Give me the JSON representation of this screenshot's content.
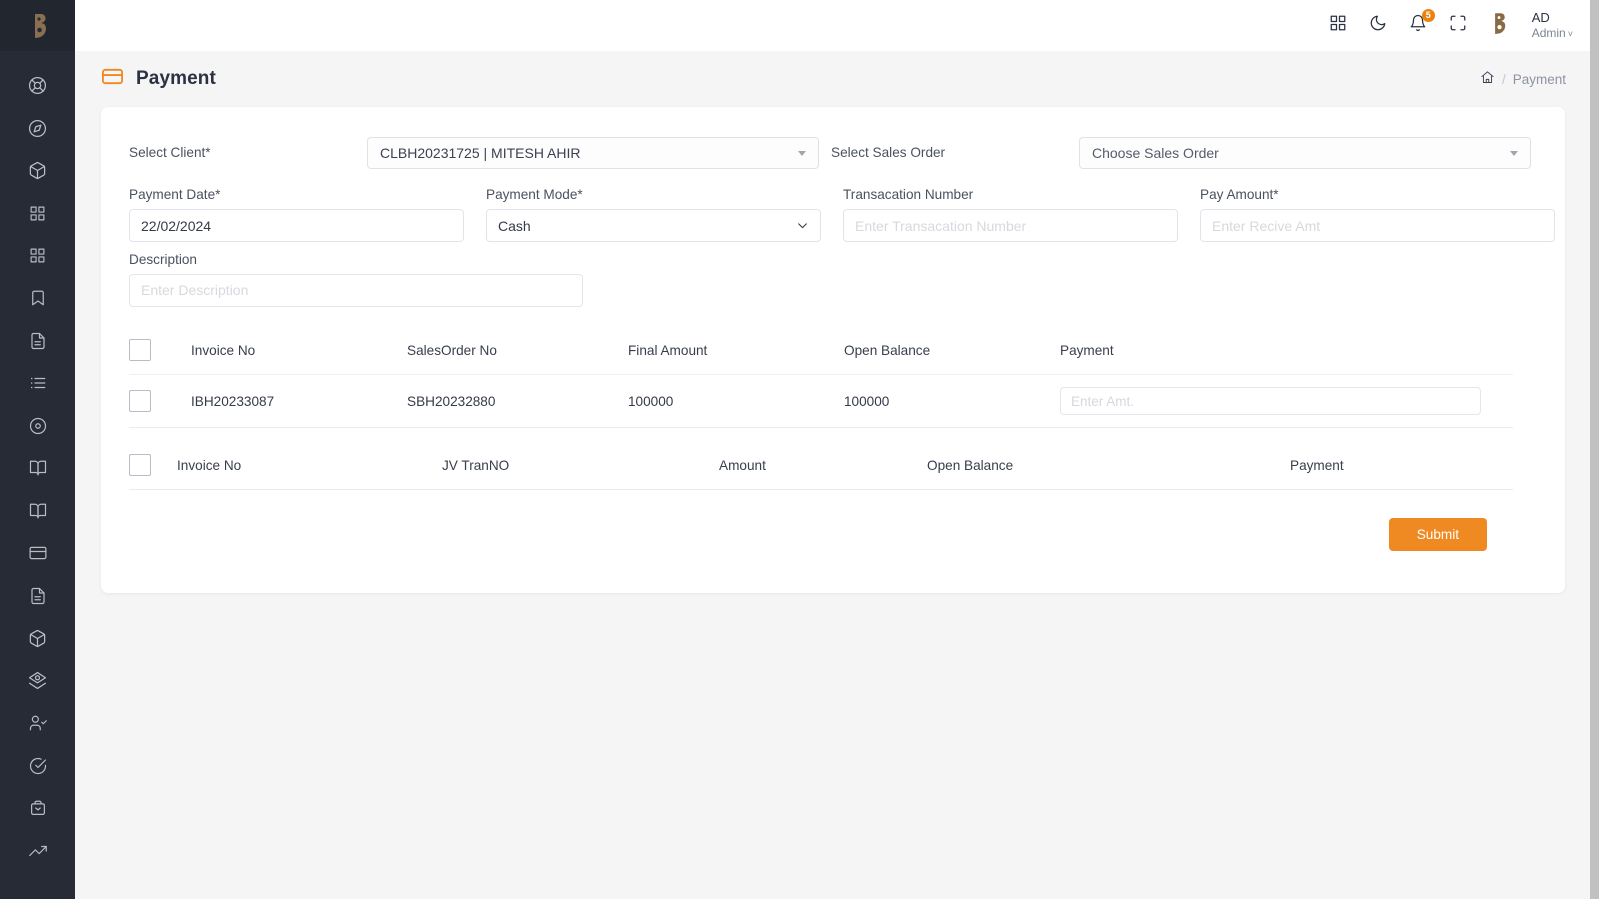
{
  "sidebar": {
    "logo_icon": "brand-b-logo",
    "items": [
      {
        "icon": "lifebuoy-icon",
        "name": "support"
      },
      {
        "icon": "compass-icon",
        "name": "explore"
      },
      {
        "icon": "box-icon",
        "name": "products"
      },
      {
        "icon": "grid-icon",
        "name": "categories"
      },
      {
        "icon": "grid-icon",
        "name": "sub-categories"
      },
      {
        "icon": "bookmark-icon",
        "name": "bookmarks"
      },
      {
        "icon": "file-text-icon",
        "name": "documents"
      },
      {
        "icon": "list-icon",
        "name": "lists"
      },
      {
        "icon": "disc-icon",
        "name": "disc"
      },
      {
        "icon": "book-open-icon",
        "name": "ledger"
      },
      {
        "icon": "book-open-icon",
        "name": "journal"
      },
      {
        "icon": "credit-card-icon",
        "name": "payment"
      },
      {
        "icon": "file-text-icon",
        "name": "invoices"
      },
      {
        "icon": "box-icon",
        "name": "inventory"
      },
      {
        "icon": "layers-icon",
        "name": "stock"
      },
      {
        "icon": "user-check-icon",
        "name": "clients"
      },
      {
        "icon": "check-circle-icon",
        "name": "approvals"
      },
      {
        "icon": "briefcase-icon",
        "name": "orders"
      },
      {
        "icon": "trending-up-icon",
        "name": "reports"
      }
    ]
  },
  "topbar": {
    "apps_icon": "grid-apps-icon",
    "dark_mode_icon": "moon-icon",
    "notifications_icon": "bell-icon",
    "notifications_count": "5",
    "fullscreen_icon": "fullscreen-icon",
    "brand_icon": "brand-b-logo",
    "user_initials": "AD",
    "user_role": "Admin",
    "user_caret": "˅"
  },
  "page": {
    "icon": "credit-card-icon",
    "title": "Payment",
    "breadcrumb": {
      "home_icon": "home-icon",
      "separator": "/",
      "current": "Payment"
    }
  },
  "form": {
    "select_client": {
      "label": "Select Client*",
      "value": "CLBH20231725 | MITESH AHIR"
    },
    "select_sales_order": {
      "label": "Select Sales Order",
      "value": "Choose Sales Order"
    },
    "payment_date": {
      "label": "Payment Date*",
      "value": "22/02/2024"
    },
    "payment_mode": {
      "label": "Payment Mode*",
      "value": "Cash"
    },
    "transaction_number": {
      "label": "Transacation Number",
      "value": "",
      "placeholder": "Enter Transacation Number"
    },
    "pay_amount": {
      "label": "Pay Amount*",
      "value": "",
      "placeholder": "Enter Recive Amt"
    },
    "description": {
      "label": "Description",
      "value": "",
      "placeholder": "Enter Description"
    }
  },
  "invoice_table": {
    "headers": [
      "Invoice No",
      "SalesOrder No",
      "Final Amount",
      "Open Balance",
      "Payment"
    ],
    "rows": [
      {
        "invoice_no": "IBH20233087",
        "salesorder_no": "SBH20232880",
        "final_amount": "100000",
        "open_balance": "100000",
        "payment_placeholder": "Enter Amt."
      }
    ]
  },
  "jv_table": {
    "headers": [
      "Invoice No",
      "JV TranNO",
      "Amount",
      "Open Balance",
      "Payment"
    ],
    "rows": []
  },
  "actions": {
    "submit_label": "Submit"
  },
  "colors": {
    "accent": "#ef8a22",
    "sidebar_bg": "#262b35",
    "page_bg": "#f5f5f5",
    "brand_logo": "#8a7050"
  }
}
